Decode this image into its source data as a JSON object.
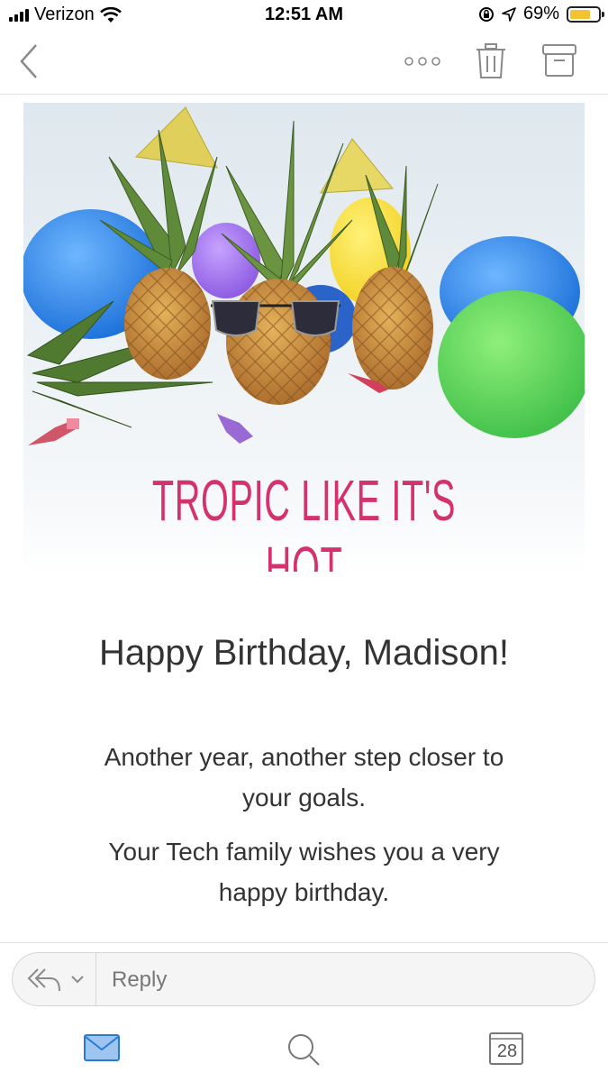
{
  "status_bar": {
    "carrier": "Verizon",
    "time": "12:51 AM",
    "battery": "69%",
    "battery_color": "#f2c230"
  },
  "toolbar": {
    "back_icon": "chevron-left-icon",
    "more_icon": "more-horizontal-icon",
    "delete_icon": "trash-icon",
    "archive_icon": "archive-icon"
  },
  "email": {
    "hero_tagline": "TROPIC LIKE IT'S HOT",
    "greeting": "Happy Birthday, Madison!",
    "paragraph_1": "Another year, another step closer to your goals.",
    "paragraph_2": "Your Tech family wishes you a very happy birthday."
  },
  "reply": {
    "placeholder": "Reply",
    "icon": "reply-all-icon"
  },
  "tabbar": {
    "mail_icon": "mail-icon",
    "search_icon": "search-icon",
    "calendar_day": "28",
    "active_color": "#2a7ad4"
  }
}
